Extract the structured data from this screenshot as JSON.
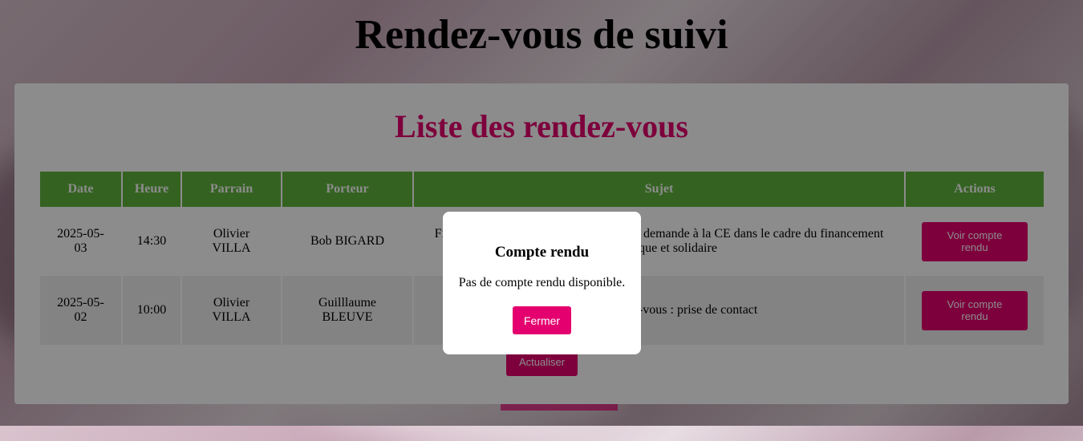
{
  "page": {
    "title": "Rendez-vous de suivi"
  },
  "card": {
    "title": "Liste des rendez-vous"
  },
  "table": {
    "headers": [
      "Date",
      "Heure",
      "Parrain",
      "Porteur",
      "Sujet",
      "Actions"
    ],
    "rows": [
      {
        "date": "2025-05-03",
        "heure": "14:30",
        "parrain": "Olivier VILLA",
        "porteur": "Bob BIGARD",
        "sujet": "Financement : préparation du dossier de demande à la CE dans le cadre du financement écologique et solidaire",
        "action": "Voir compte rendu"
      },
      {
        "date": "2025-05-02",
        "heure": "10:00",
        "parrain": "Olivier VILLA",
        "porteur": "Guilllaume BLEUVE",
        "sujet": "Premier rendez-vous : prise de contact",
        "action": "Voir compte rendu"
      }
    ]
  },
  "refresh_label": "Actualiser",
  "modal": {
    "title": "Compte rendu",
    "body": "Pas de compte rendu disponible.",
    "close_label": "Fermer"
  },
  "colors": {
    "accent": "#e4006e",
    "header_green": "#5fb43c"
  }
}
